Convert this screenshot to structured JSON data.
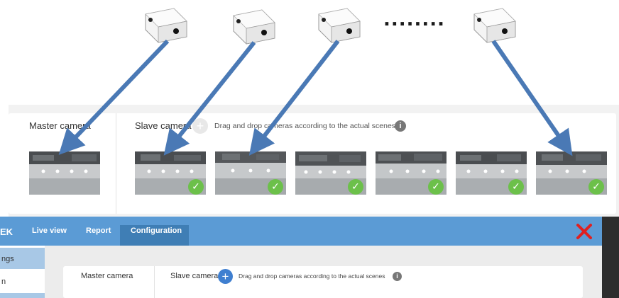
{
  "top": {
    "ellipsis": "........"
  },
  "magnified": {
    "master_label": "Master camera",
    "slave_label": "Slave camera",
    "add_icon": "+",
    "hint": "Drag and drop cameras according to the actual scenes",
    "info_icon": "i",
    "check_icon": "✓"
  },
  "app": {
    "brand": "EK",
    "nav": [
      "Live view",
      "Report",
      "Configuration"
    ],
    "active_tab": "Configuration",
    "sidebar": [
      "ngs",
      "n"
    ],
    "master_label": "Master camera",
    "slave_label": "Slave camera",
    "add_icon": "+",
    "hint": "Drag and drop cameras according to the actual scenes",
    "info_icon": "i"
  },
  "colors": {
    "topbar": "#5b9bd5",
    "active_tab": "#3f7eb5",
    "arrow": "#4a79b5",
    "check": "#6cc04a",
    "close": "#e02020"
  }
}
